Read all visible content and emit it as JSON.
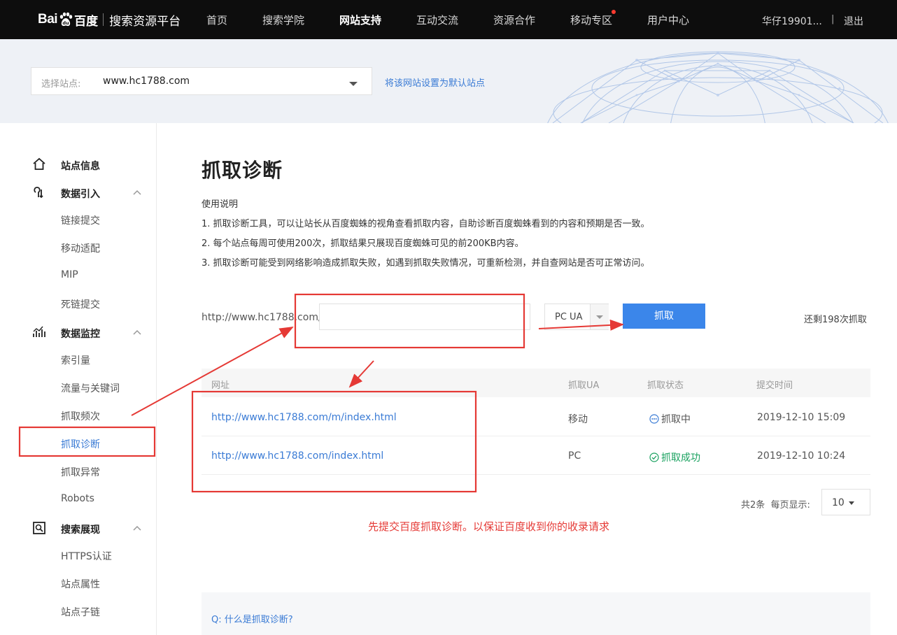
{
  "header": {
    "logo_bai": "Bai",
    "logo_du": "百度",
    "platform": "搜索资源平台",
    "nav": [
      "首页",
      "搜索学院",
      "网站支持",
      "互动交流",
      "资源合作",
      "移动专区",
      "用户中心"
    ],
    "active_nav": "网站支持",
    "username": "华仔19901...",
    "separator": "|",
    "logout": "退出"
  },
  "banner": {
    "select_label": "选择站点:",
    "selected_site": "www.hc1788.com",
    "set_default": "将该网站设置为默认站点"
  },
  "sidebar": {
    "groups": [
      {
        "label": "站点信息",
        "icon": "home-icon"
      },
      {
        "label": "数据引入",
        "icon": "data-import-icon",
        "items": [
          "链接提交",
          "移动适配",
          "MIP",
          "死链提交"
        ]
      },
      {
        "label": "数据监控",
        "icon": "chart-icon",
        "items": [
          "索引量",
          "流量与关键词",
          "抓取频次",
          "抓取诊断",
          "抓取异常",
          "Robots"
        ]
      },
      {
        "label": "搜索展现",
        "icon": "search-display-icon",
        "items": [
          "HTTPS认证",
          "站点属性",
          "站点子链"
        ]
      }
    ],
    "active_item": "抓取诊断"
  },
  "main": {
    "title": "抓取诊断",
    "instructions": [
      "使用说明",
      "1. 抓取诊断工具，可以让站长从百度蜘蛛的视角查看抓取内容，自助诊断百度蜘蛛看到的内容和预期是否一致。",
      "2. 每个站点每周可使用200次，抓取结果只展现百度蜘蛛可见的前200KB内容。",
      "3. 抓取诊断可能受到网络影响造成抓取失败，如遇到抓取失败情况，可重新检测，并自查网站是否可正常访问。"
    ],
    "url_prefix": "http://www.hc1788.com/",
    "url_input_value": "",
    "ua_value": "PC UA",
    "fetch_button": "抓取",
    "remaining": "还剩198次抓取"
  },
  "table": {
    "headers": [
      "网址",
      "抓取UA",
      "抓取状态",
      "提交时间"
    ],
    "rows": [
      {
        "url": "http://www.hc1788.com/m/index.html",
        "ua": "移动",
        "status": "抓取中",
        "status_icon": "loading-dots-icon",
        "time": "2019-12-10 15:09"
      },
      {
        "url": "http://www.hc1788.com/index.html",
        "ua": "PC",
        "status": "抓取成功",
        "status_icon": "success-check-icon",
        "time": "2019-12-10 10:24"
      }
    ],
    "total": "共2条",
    "per_page_label": "每页显示:",
    "per_page_value": "10"
  },
  "annotation_note": "先提交百度抓取诊断。以保证百度收到你的收录请求",
  "faq_question": "Q: 什么是抓取诊断?",
  "colors": {
    "topbar": "#0d0d0d",
    "accent": "#3b86ea",
    "link": "#3a7bd5",
    "annotation_red": "#e53935",
    "success": "#19a15f"
  }
}
